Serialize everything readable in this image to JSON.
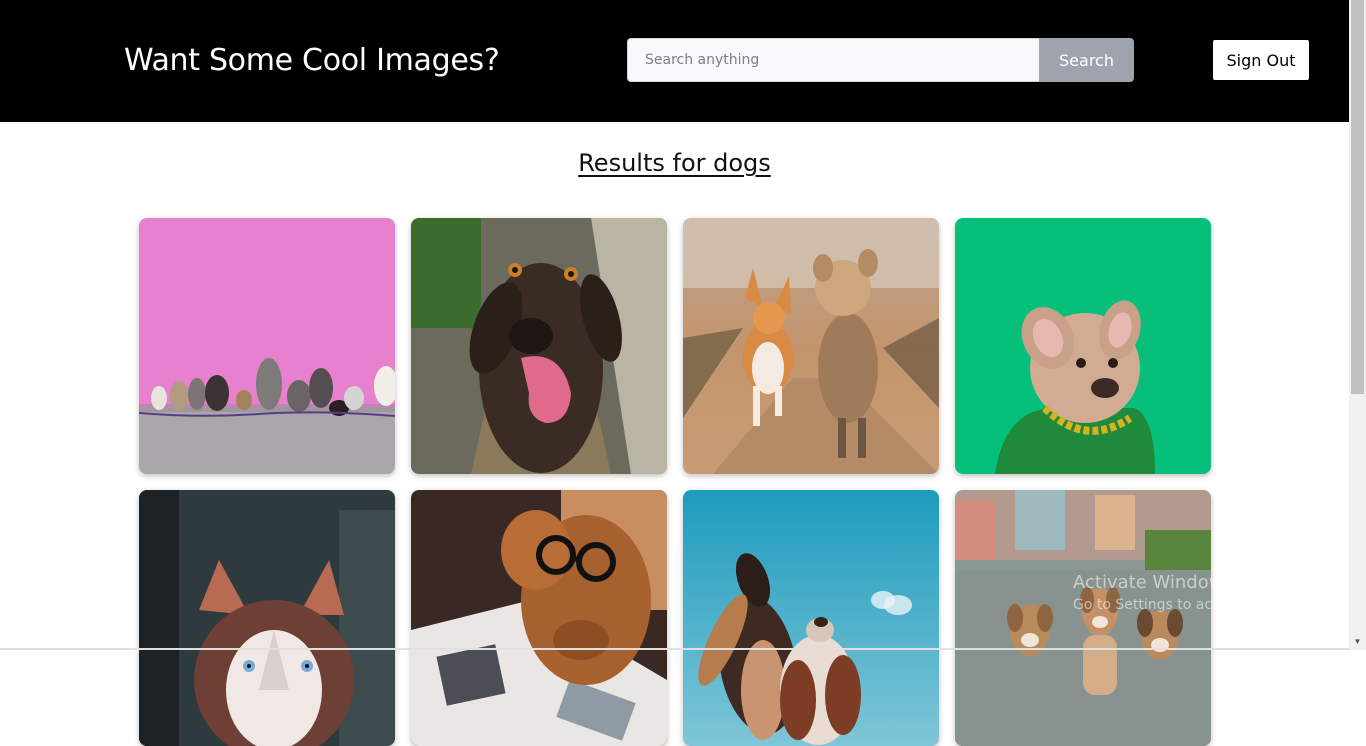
{
  "header": {
    "brand": "Want Some Cool Images?",
    "search_placeholder": "Search anything",
    "search_value": "",
    "search_label": "Search",
    "signout_label": "Sign Out"
  },
  "results": {
    "title": "Results for dogs"
  },
  "images": [
    {
      "name": "dogs-pink-wall"
    },
    {
      "name": "labrador-tongue"
    },
    {
      "name": "corgi-yorkie-running"
    },
    {
      "name": "french-bulldog-green"
    },
    {
      "name": "husky-portrait"
    },
    {
      "name": "dog-glasses-reading"
    },
    {
      "name": "dogs-blue-sky"
    },
    {
      "name": "puppies-field"
    }
  ],
  "watermark": {
    "line1": "Activate Windows",
    "line2": "Go to Settings to activate Windows."
  },
  "colors": {
    "header_bg": "#000000",
    "search_button_bg": "#9ea3ad",
    "search_input_bg": "#f8f9fa"
  }
}
